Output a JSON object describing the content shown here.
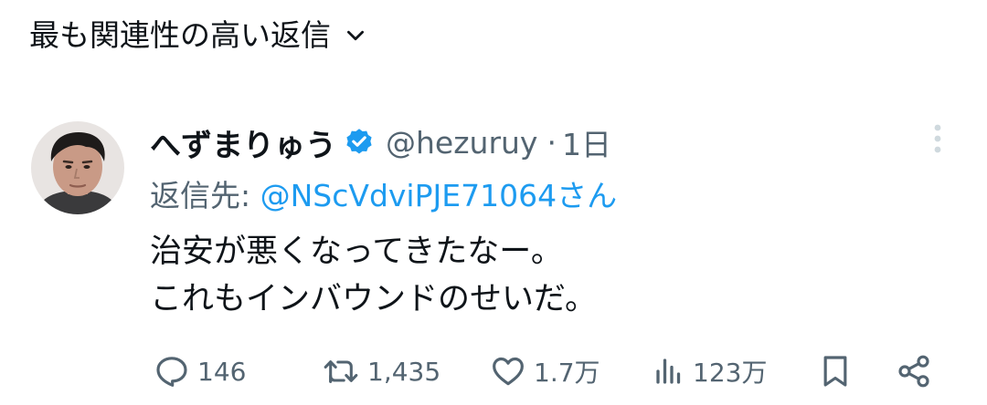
{
  "header": {
    "sort_label": "最も関連性の高い返信"
  },
  "tweet": {
    "display_name": "へずまりゅう",
    "handle": "@hezuruy",
    "separator": "·",
    "time": "1日",
    "reply_prefix": "返信先: ",
    "reply_target": "@NScVdviPJE71064さん",
    "text_lines": [
      "治安が悪くなってきたなー。",
      "これもインバウンドのせいだ。"
    ],
    "actions": {
      "replies": "146",
      "reposts": "1,435",
      "likes": "1.7万",
      "views": "123万"
    }
  },
  "colors": {
    "text_primary": "#0f1419",
    "text_secondary": "#536471",
    "accent": "#1d9bf0",
    "icon_muted": "#cfd9de"
  },
  "icons": {
    "sort": "chevron-down-icon",
    "verified": "verified-badge-icon",
    "more": "more-vertical-icon",
    "reply": "reply-icon",
    "repost": "repost-icon",
    "like": "heart-icon",
    "views": "analytics-icon",
    "bookmark": "bookmark-icon",
    "share": "share-icon"
  }
}
